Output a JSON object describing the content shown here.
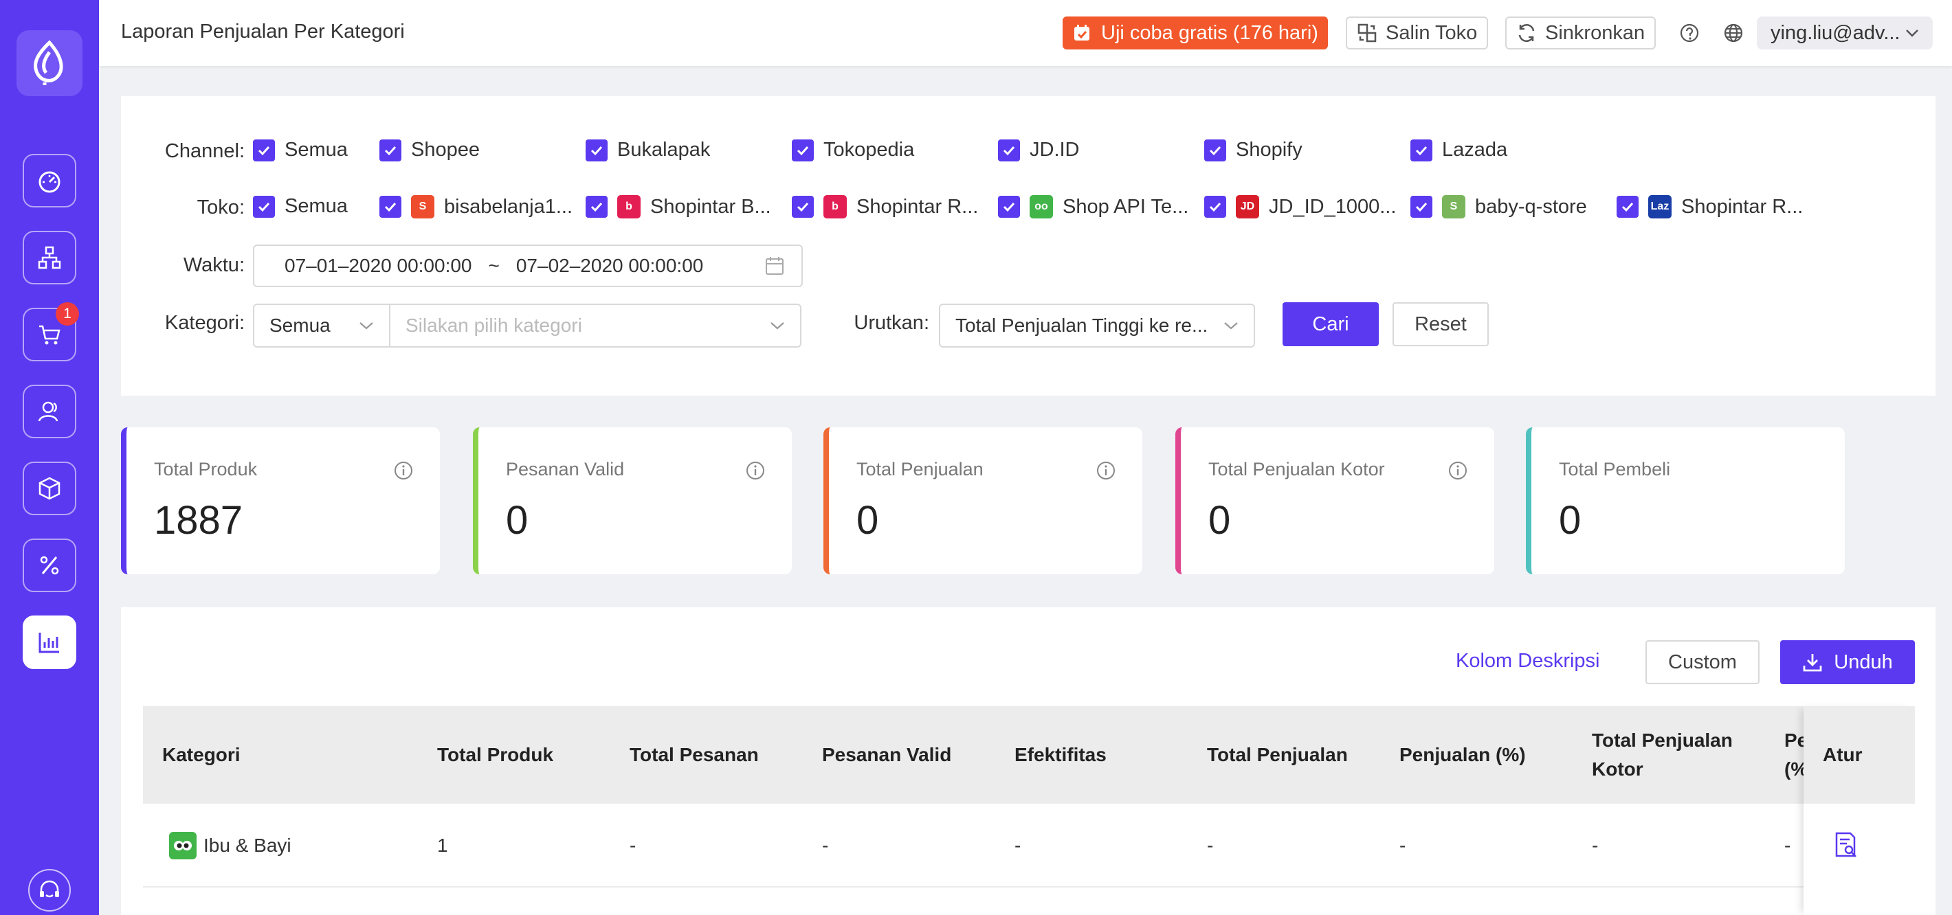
{
  "colors": {
    "primary": "#5a39f0",
    "trial": "#f2582b",
    "card_borders": [
      "#5a39f0",
      "#8bd14a",
      "#f06a35",
      "#e0468f",
      "#4fc1bf"
    ]
  },
  "sidebar": {
    "icons": [
      "dashboard-icon",
      "network-icon",
      "cart-icon",
      "user-icon",
      "box-icon",
      "percent-icon",
      "chart-icon"
    ],
    "cart_badge": "1",
    "active": "chart-icon"
  },
  "header": {
    "title": "Laporan Penjualan Per Kategori",
    "trial_label": "Uji coba gratis (176 hari)",
    "copy_store_label": "Salin Toko",
    "sync_label": "Sinkronkan",
    "user_label": "ying.liu@adv..."
  },
  "filters": {
    "channel_label": "Channel",
    "channels": [
      "Semua",
      "Shopee",
      "Bukalapak",
      "Tokopedia",
      "JD.ID",
      "Shopify",
      "Lazada"
    ],
    "store_label": "Toko",
    "store_all": "Semua",
    "stores": [
      "bisabelanja1...",
      "Shopintar B...",
      "Shopintar R...",
      "Shop API Te...",
      "JD_ID_1000...",
      "baby-q-store",
      "Shopintar R..."
    ],
    "time_label": "Waktu",
    "date_start": "07–01–2020 00:00:00",
    "date_sep": "~",
    "date_end": "07–02–2020 00:00:00",
    "category_label": "Kategori",
    "category_scope": "Semua",
    "category_placeholder": "Silakan pilih kategori",
    "sort_label": "Urutkan",
    "sort_value": "Total Penjualan Tinggi ke re...",
    "search_label": "Cari",
    "reset_label": "Reset"
  },
  "stats": [
    {
      "label": "Total Produk",
      "value": "1887"
    },
    {
      "label": "Pesanan Valid",
      "value": "0"
    },
    {
      "label": "Total Penjualan",
      "value": "0"
    },
    {
      "label": "Total Penjualan Kotor",
      "value": "0"
    },
    {
      "label": "Total Pembeli",
      "value": "0"
    }
  ],
  "table": {
    "description_link": "Kolom Deskripsi",
    "custom_label": "Custom",
    "download_label": "Unduh",
    "columns": [
      "Kategori",
      "Total Produk",
      "Total Pesanan",
      "Pesanan Valid",
      "Efektifitas",
      "Total Penjualan",
      "Penjualan (%)",
      "Total Penjualan Kotor",
      "Pe (%",
      "Atur"
    ],
    "rows": [
      {
        "category": "Ibu & Bayi",
        "total_produk": "1",
        "total_pesanan": "-",
        "pesanan_valid": "-",
        "efektifitas": "-",
        "total_penjualan": "-",
        "penjualan_pct": "-",
        "total_kotor": "-",
        "pe_pct": "-"
      }
    ]
  }
}
